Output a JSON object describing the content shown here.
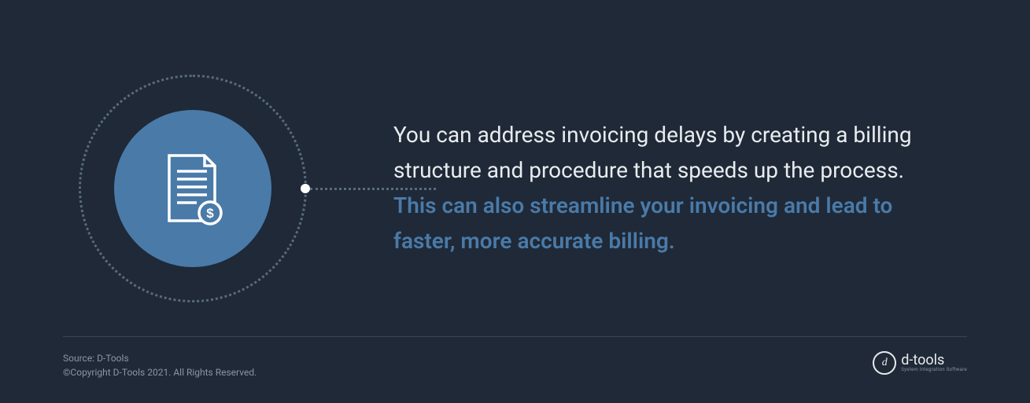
{
  "content": {
    "text_primary": "You can address invoicing delays by creating a billing structure and procedure that speeds up the process. ",
    "text_highlight": "This can also streamline your invoicing and lead to faster, more accurate billing."
  },
  "footer": {
    "source": "Source: D-Tools",
    "copyright": "©Copyright D-Tools 2021. All Rights Reserved."
  },
  "logo": {
    "icon_letter": "d",
    "brand": "d-tools",
    "tagline": "System Integration Software"
  },
  "colors": {
    "background": "#1f2937",
    "accent": "#4a7aa8",
    "text_light": "#e8ecef",
    "text_muted": "#8a96a4"
  }
}
